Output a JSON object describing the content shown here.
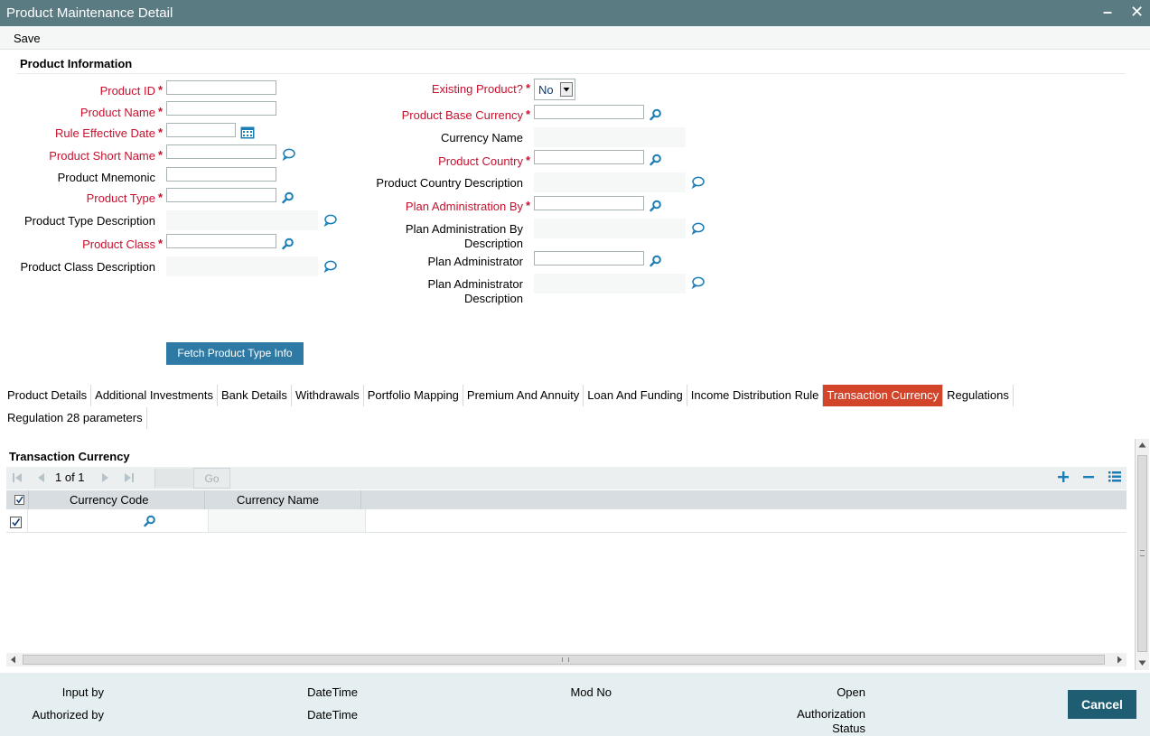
{
  "window": {
    "title": "Product Maintenance Detail",
    "minimize": "–",
    "close": "✕"
  },
  "menu": {
    "save": "Save"
  },
  "section": {
    "product_information": "Product Information"
  },
  "left_fields": {
    "product_id": "Product ID",
    "product_name": "Product Name",
    "rule_effective_date": "Rule Effective Date",
    "product_short_name": "Product Short Name",
    "product_mnemonic": "Product Mnemonic",
    "product_type": "Product Type",
    "product_type_description": "Product Type Description",
    "product_class": "Product Class",
    "product_class_description": "Product Class Description"
  },
  "right_fields": {
    "existing_product": "Existing Product?",
    "existing_product_value": "No",
    "product_base_currency": "Product Base Currency",
    "currency_name": "Currency Name",
    "product_country": "Product Country",
    "product_country_description": "Product Country Description",
    "plan_administration_by": "Plan Administration By",
    "plan_administration_by_description_1": "Plan Administration By",
    "plan_administration_by_description_2": "Description",
    "plan_administrator": "Plan Administrator",
    "plan_administrator_description_1": "Plan Administrator",
    "plan_administrator_description_2": "Description"
  },
  "required_mark": "*",
  "buttons": {
    "fetch_product_type_info": "Fetch Product Type Info",
    "cancel": "Cancel",
    "go": "Go"
  },
  "tabs": [
    "Product Details",
    "Additional Investments",
    "Bank Details",
    "Withdrawals",
    "Portfolio Mapping",
    "Premium And Annuity",
    "Loan And Funding",
    "Income Distribution Rule",
    "Transaction Currency",
    "Regulations",
    "Regulation 28 parameters"
  ],
  "active_tab": "Transaction Currency",
  "grid": {
    "title": "Transaction Currency",
    "pager": "1 of 1",
    "columns": [
      "Currency Code",
      "Currency Name"
    ]
  },
  "footer": {
    "input_by": "Input by",
    "authorized_by": "Authorized by",
    "datetime_1": "DateTime",
    "datetime_2": "DateTime",
    "mod_no": "Mod No",
    "open": "Open",
    "authorization_status_1": "Authorization",
    "authorization_status_2": "Status"
  },
  "colors": {
    "titlebar": "#5b7b83",
    "required": "#c8102e",
    "active_tab": "#d2452a",
    "fetch_button": "#2e7aa4",
    "cancel_button": "#1f5e72",
    "icon": "#1a7db5"
  }
}
